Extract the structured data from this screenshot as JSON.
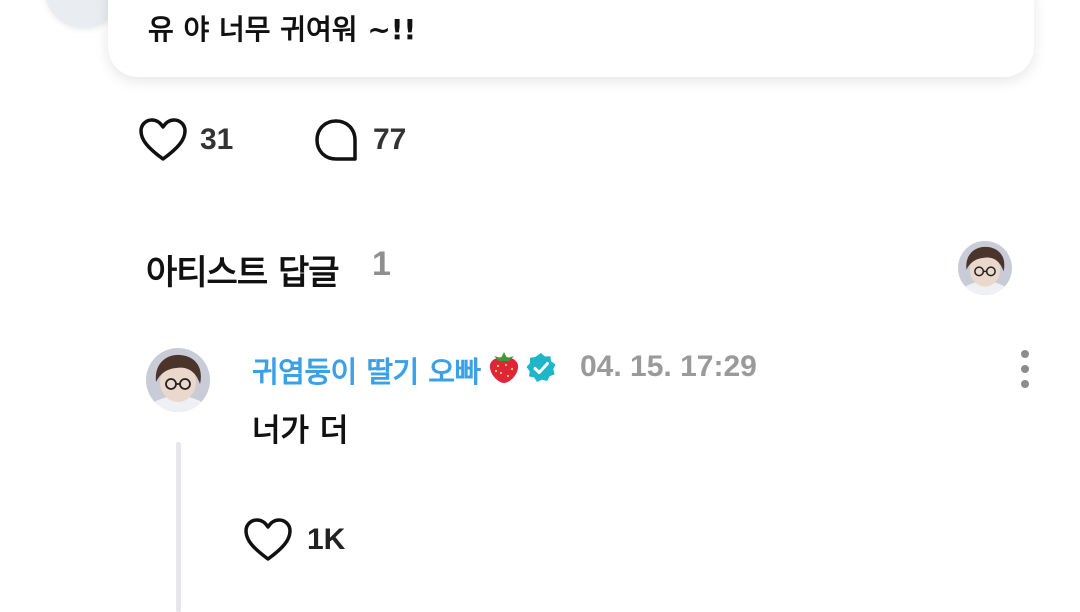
{
  "post": {
    "text": "유 야 너무 귀여워 ~!!",
    "like_count": "31",
    "comment_count": "77"
  },
  "artist_replies": {
    "title": "아티스트 답글",
    "count": "1"
  },
  "reply": {
    "author": "귀염둥이 딸기 오빠",
    "author_emoji": "🍓",
    "verified_icon": "verified-badge-icon",
    "timestamp": "04. 15. 17:29",
    "text": "너가 더",
    "like_count": "1K"
  },
  "colors": {
    "author_name": "#3aa0e8",
    "verified_badge": "#1fb6c9",
    "muted_text": "#9a9a9a",
    "thread_line": "#e6e6ec"
  }
}
